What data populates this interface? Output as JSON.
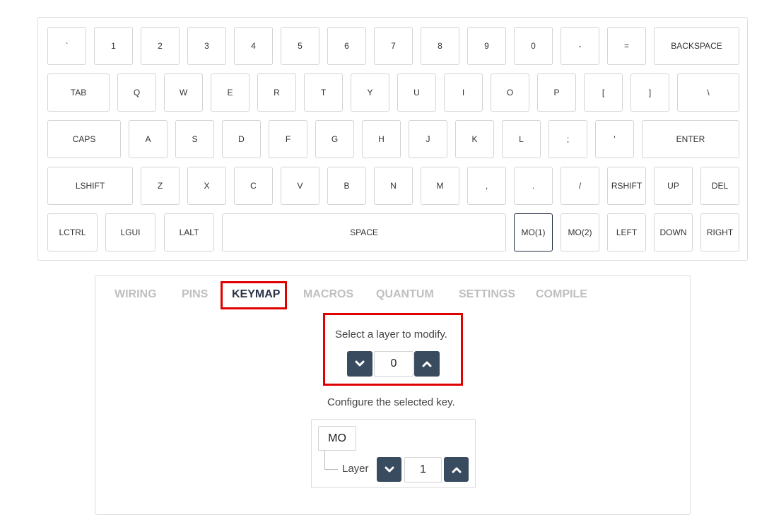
{
  "keyboard": {
    "keys": [
      "`",
      "1",
      "2",
      "3",
      "4",
      "5",
      "6",
      "7",
      "8",
      "9",
      "0",
      "-",
      "=",
      "BACKSPACE",
      "TAB",
      "Q",
      "W",
      "E",
      "R",
      "T",
      "Y",
      "U",
      "I",
      "O",
      "P",
      "[",
      "]",
      "\\",
      "CAPS",
      "A",
      "S",
      "D",
      "F",
      "G",
      "H",
      "J",
      "K",
      "L",
      ";",
      "'",
      "ENTER",
      "LSHIFT",
      "Z",
      "X",
      "C",
      "V",
      "B",
      "N",
      "M",
      ",",
      ".",
      "/",
      "RSHIFT",
      "UP",
      "DEL",
      "LCTRL",
      "LGUI",
      "LALT",
      "SPACE",
      "MO(1)",
      "MO(2)",
      "LEFT",
      "DOWN",
      "RIGHT"
    ],
    "selected_key": "MO(1)"
  },
  "tabs": [
    "WIRING",
    "PINS",
    "KEYMAP",
    "MACROS",
    "QUANTUM",
    "SETTINGS",
    "COMPILE"
  ],
  "active_tab": "KEYMAP",
  "layer": {
    "prompt": "Select a layer to modify.",
    "value": "0",
    "down_icon": "chevron-down-icon",
    "up_icon": "chevron-up-icon"
  },
  "configure": {
    "prompt": "Configure the selected key.",
    "keycode": "MO",
    "param_label": "Layer",
    "param_value": "1"
  },
  "colors": {
    "highlight": "#e10000",
    "button": "#394b5e",
    "active_tab": "#2b3548",
    "inactive_tab": "#bfbfbf"
  }
}
